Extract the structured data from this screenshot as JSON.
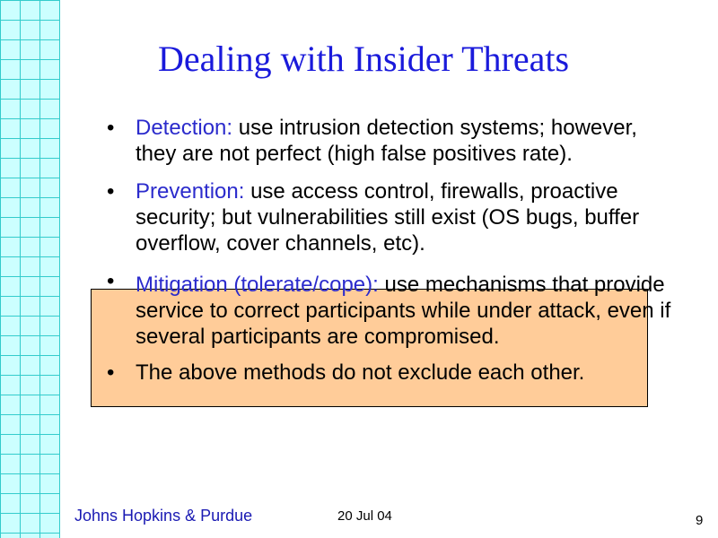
{
  "slide": {
    "title": "Dealing with Insider Threats",
    "bullets": [
      {
        "lead": "Detection:",
        "text": " use intrusion detection systems; however, they are not perfect (high false positives rate)."
      },
      {
        "lead": "Prevention:",
        "text": " use access control, firewalls, proactive security; but vulnerabilities still exist (OS bugs, buffer overflow, cover channels, etc)."
      },
      {
        "lead": "Mitigation (tolerate/cope):",
        "text": " use mechanisms that provide service to correct participants while under attack, even if several participants are compromised.",
        "highlighted": true
      },
      {
        "lead": "",
        "text": "The above methods do not exclude each other."
      }
    ],
    "bullet_glyph": "•",
    "footer": {
      "organization": "Johns Hopkins & Purdue",
      "date": "20 Jul 04",
      "page_number": "9"
    },
    "colors": {
      "title": "#1a1adb",
      "lead_term": "#2b2bcc",
      "highlight_box": "#ffcc99",
      "grid_fill": "#ccffff",
      "grid_line": "#33cccc"
    }
  }
}
